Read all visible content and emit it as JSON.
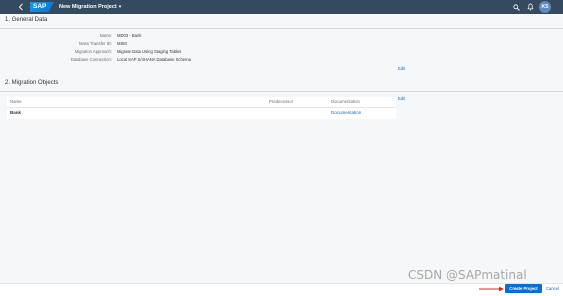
{
  "shellbar": {
    "logo_text": "SAP",
    "title": "New Migration Project",
    "caret": "▾",
    "user_initials": "KS"
  },
  "general_data": {
    "title": "1. General Data",
    "fields": [
      {
        "label": "Name:",
        "value": "MD03 - Bank"
      },
      {
        "label": "Mass Transfer ID:",
        "value": "MSM"
      },
      {
        "label": "Migration Approach:",
        "value": "Migrate Data Using Staging Tables"
      },
      {
        "label": "Database Connection:",
        "value": "Local SAP S/4HANA Database Schema"
      }
    ],
    "edit_label": "Edit"
  },
  "migration_objects": {
    "title": "2. Migration Objects",
    "edit_label": "Edit",
    "columns": [
      "Name",
      "Predecessor",
      "Documentation"
    ],
    "rows": [
      {
        "name": "Bank",
        "predecessor": "",
        "documentation": "Documentation"
      }
    ]
  },
  "footer": {
    "create_label": "Create Project",
    "cancel_label": "Cancel"
  },
  "watermark": "CSDN @SAPmatinal",
  "colors": {
    "shellbar": "#354a5f",
    "accent": "#0a6ed1",
    "annotation_arrow": "#e02020"
  }
}
